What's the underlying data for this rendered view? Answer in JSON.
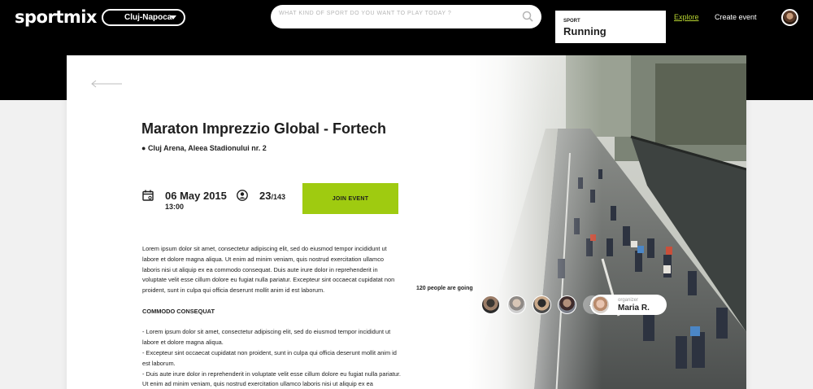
{
  "header": {
    "logo": "sportmix",
    "city": "Cluj-Napoca",
    "search_placeholder": "WHAT KIND OF SPORT DO YOU WANT TO PLAY TODAY ?",
    "nav": {
      "explore": "Explore",
      "create": "Create event"
    }
  },
  "event": {
    "title": "Maraton Imprezzio Global - Fortech",
    "location": "Cluj Arena, Aleea Stadionului nr. 2",
    "date": "06 May 2015",
    "time": "13:00",
    "participants": "23",
    "capacity": "/143",
    "join_label": "JOIN EVENT",
    "sport_label": "SPORT",
    "sport_name": "Running",
    "going_text": "120 people are going",
    "add_label": "+",
    "organizer_label": "organizer",
    "organizer_name": "Maria R."
  },
  "description": {
    "paragraph": "Lorem ipsum dolor sit amet, consectetur adipiscing elit, sed do eiusmod tempor incididunt ut labore et dolore magna aliqua. Ut enim ad minim veniam, quis nostrud exercitation ullamco laboris nisi ut aliquip ex ea commodo consequat. Duis aute irure dolor in reprehenderit in voluptate velit esse cillum dolore eu fugiat nulla pariatur. Excepteur sint occaecat cupidatat non proident, sunt in culpa qui officia deserunt mollit anim id est laborum.",
    "subheading": "COMMODO CONSEQUAT",
    "bullets": [
      "- Lorem ipsum dolor sit amet, consectetur adipiscing elit, sed do eiusmod tempor incididunt ut labore et dolore magna aliqua.",
      "- Excepteur sint occaecat cupidatat non proident, sunt in culpa qui officia deserunt mollit anim id est laborum.",
      "- Duis aute irure dolor in reprehenderit in voluptate velit esse cillum dolore eu fugiat nulla pariatur. Ut enim ad minim veniam, quis nostrud exercitation ullamco laboris nisi ut aliquip ex ea commodo"
    ]
  },
  "colors": {
    "accent": "#9fcb10",
    "nav_active": "#b7d431",
    "topbar": "#000000"
  },
  "icons": {
    "search": "search-icon",
    "calendar": "calendar-icon",
    "person": "person-icon",
    "back": "back-arrow-icon"
  }
}
